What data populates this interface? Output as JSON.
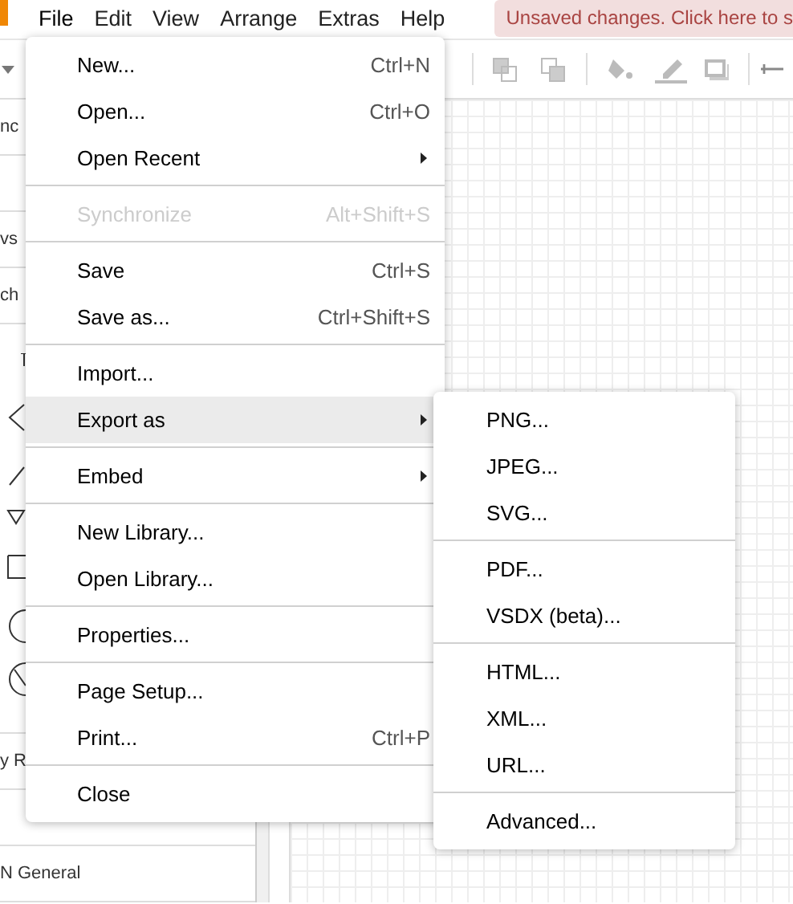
{
  "menubar": {
    "items": [
      {
        "label": "File",
        "selected": true
      },
      {
        "label": "Edit",
        "selected": false
      },
      {
        "label": "View",
        "selected": false
      },
      {
        "label": "Arrange",
        "selected": false
      },
      {
        "label": "Extras",
        "selected": false
      },
      {
        "label": "Help",
        "selected": false
      }
    ],
    "notice": "Unsaved changes. Click here to s"
  },
  "sidebar": {
    "rows": [
      {
        "kind": "text",
        "label": "nc"
      },
      {
        "kind": "blank"
      },
      {
        "kind": "text",
        "label": "vs"
      },
      {
        "kind": "text",
        "label": "ch"
      },
      {
        "kind": "shapes"
      },
      {
        "kind": "text",
        "label": "y R"
      },
      {
        "kind": "blank"
      },
      {
        "kind": "text",
        "label": "N General"
      }
    ]
  },
  "file_menu": {
    "items": [
      {
        "kind": "item",
        "label": "New...",
        "shortcut": "Ctrl+N",
        "submenu": false,
        "disabled": false,
        "selected": false
      },
      {
        "kind": "item",
        "label": "Open...",
        "shortcut": "Ctrl+O",
        "submenu": false,
        "disabled": false,
        "selected": false
      },
      {
        "kind": "item",
        "label": "Open Recent",
        "submenu": true,
        "disabled": false,
        "selected": false
      },
      {
        "kind": "separator"
      },
      {
        "kind": "item",
        "label": "Synchronize",
        "shortcut": "Alt+Shift+S",
        "submenu": false,
        "disabled": true,
        "selected": false
      },
      {
        "kind": "separator"
      },
      {
        "kind": "item",
        "label": "Save",
        "shortcut": "Ctrl+S",
        "submenu": false,
        "disabled": false,
        "selected": false
      },
      {
        "kind": "item",
        "label": "Save as...",
        "shortcut": "Ctrl+Shift+S",
        "submenu": false,
        "disabled": false,
        "selected": false
      },
      {
        "kind": "separator"
      },
      {
        "kind": "item",
        "label": "Import...",
        "submenu": false,
        "disabled": false,
        "selected": false
      },
      {
        "kind": "item",
        "label": "Export as",
        "submenu": true,
        "disabled": false,
        "selected": true
      },
      {
        "kind": "separator"
      },
      {
        "kind": "item",
        "label": "Embed",
        "submenu": true,
        "disabled": false,
        "selected": false
      },
      {
        "kind": "separator"
      },
      {
        "kind": "item",
        "label": "New Library...",
        "submenu": false,
        "disabled": false,
        "selected": false
      },
      {
        "kind": "item",
        "label": "Open Library...",
        "submenu": false,
        "disabled": false,
        "selected": false
      },
      {
        "kind": "separator"
      },
      {
        "kind": "item",
        "label": "Properties...",
        "submenu": false,
        "disabled": false,
        "selected": false
      },
      {
        "kind": "separator"
      },
      {
        "kind": "item",
        "label": "Page Setup...",
        "submenu": false,
        "disabled": false,
        "selected": false
      },
      {
        "kind": "item",
        "label": "Print...",
        "shortcut": "Ctrl+P",
        "submenu": false,
        "disabled": false,
        "selected": false
      },
      {
        "kind": "separator"
      },
      {
        "kind": "item",
        "label": "Close",
        "submenu": false,
        "disabled": false,
        "selected": false
      }
    ]
  },
  "export_submenu": {
    "items": [
      {
        "kind": "item",
        "label": "PNG...",
        "selected": false
      },
      {
        "kind": "item",
        "label": "JPEG...",
        "selected": false
      },
      {
        "kind": "item",
        "label": "SVG...",
        "selected": false
      },
      {
        "kind": "separator"
      },
      {
        "kind": "item",
        "label": "PDF...",
        "selected": false
      },
      {
        "kind": "item",
        "label": "VSDX (beta)...",
        "selected": false
      },
      {
        "kind": "separator"
      },
      {
        "kind": "item",
        "label": "HTML...",
        "selected": false
      },
      {
        "kind": "item",
        "label": "XML...",
        "selected": false
      },
      {
        "kind": "item",
        "label": "URL...",
        "selected": false
      },
      {
        "kind": "separator"
      },
      {
        "kind": "item",
        "label": "Advanced...",
        "selected": false
      }
    ]
  }
}
